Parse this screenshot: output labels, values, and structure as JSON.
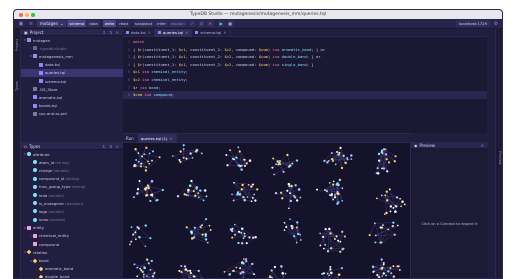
{
  "window": {
    "title": "TypeDB Studio — mutagenesis/mutagenesis_mm/queries.tql"
  },
  "colors": {
    "accent": "#8f85ff",
    "entity": "#f0a0e0",
    "relation": "#ffd46b",
    "attribute": "#7fe0ff"
  },
  "toolbar": {
    "database": "mutagen",
    "session_types": [
      "schema",
      "data"
    ],
    "transaction_types": [
      "write",
      "read"
    ],
    "options": [
      "snapshot",
      "infer",
      "explain"
    ],
    "server": "localhost:1729"
  },
  "project": {
    "title": "Project",
    "items": [
      {
        "label": "mutagen",
        "indent": 0,
        "arrow": "▾",
        "kind": "folder"
      },
      {
        "label": ".typedb-studio",
        "indent": 1,
        "arrow": "›",
        "kind": "folder-dim",
        "dim": true
      },
      {
        "label": "mutagenesis_mm",
        "indent": 1,
        "arrow": "▾",
        "kind": "folder"
      },
      {
        "label": "data.tql",
        "indent": 2,
        "arrow": "",
        "kind": "file"
      },
      {
        "label": "queries.tql",
        "indent": 2,
        "arrow": "",
        "kind": "file",
        "selected": true
      },
      {
        "label": "schema.tql",
        "indent": 2,
        "arrow": "",
        "kind": "file"
      },
      {
        "label": ".DS_Store",
        "indent": 1,
        "arrow": "",
        "kind": "file-plain"
      },
      {
        "label": "aromatic.tql",
        "indent": 1,
        "arrow": "",
        "kind": "file"
      },
      {
        "label": "bonds.tql",
        "indent": 1,
        "arrow": "",
        "kind": "file"
      },
      {
        "label": "cpc-and-ss.pnt",
        "indent": 1,
        "arrow": "",
        "kind": "file-plain"
      }
    ]
  },
  "editor": {
    "tabs": [
      {
        "label": "data.tql",
        "active": false
      },
      {
        "label": "queries.tql",
        "active": true
      },
      {
        "label": "schema.tql",
        "active": false
      }
    ],
    "lines": [
      [
        [
          "kw",
          "match"
        ]
      ],
      [
        [
          "ct",
          "{ "
        ],
        [
          "var",
          "$r"
        ],
        [
          "ct",
          "(constituent_1: "
        ],
        [
          "var",
          "$c1"
        ],
        [
          "ct",
          ", constituent_2: "
        ],
        [
          "var",
          "$c2"
        ],
        [
          "ct",
          ", compound: "
        ],
        [
          "var",
          "$com"
        ],
        [
          "ct",
          ") "
        ],
        [
          "kw",
          "isa "
        ],
        [
          "type",
          "aromatic_bond"
        ],
        [
          "ct",
          "; } or"
        ]
      ],
      [
        [
          "ct",
          "{ "
        ],
        [
          "var",
          "$r"
        ],
        [
          "ct",
          "(constituent_1: "
        ],
        [
          "var",
          "$c1"
        ],
        [
          "ct",
          ", constituent_2: "
        ],
        [
          "var",
          "$c2"
        ],
        [
          "ct",
          ", compound: "
        ],
        [
          "var",
          "$com"
        ],
        [
          "ct",
          ") "
        ],
        [
          "kw",
          "isa "
        ],
        [
          "type",
          "double_bond"
        ],
        [
          "ct",
          "; } or"
        ]
      ],
      [
        [
          "ct",
          "{ "
        ],
        [
          "var",
          "$r"
        ],
        [
          "ct",
          "(constituent_1: "
        ],
        [
          "var",
          "$c1"
        ],
        [
          "ct",
          ", constituent_2: "
        ],
        [
          "var",
          "$c2"
        ],
        [
          "ct",
          ", compound: "
        ],
        [
          "var",
          "$com"
        ],
        [
          "ct",
          ") "
        ],
        [
          "kw",
          "isa "
        ],
        [
          "type",
          "single_bond"
        ],
        [
          "ct",
          "; }"
        ]
      ],
      [
        [
          "var",
          "$c1"
        ],
        [
          "ct",
          " "
        ],
        [
          "kw",
          "isa "
        ],
        [
          "type",
          "chemical_entity"
        ],
        [
          "ct",
          ";"
        ]
      ],
      [
        [
          "var",
          "$c2"
        ],
        [
          "ct",
          " "
        ],
        [
          "kw",
          "isa "
        ],
        [
          "type",
          "chemical_entity"
        ],
        [
          "ct",
          ";"
        ]
      ],
      [
        [
          "var",
          "$r"
        ],
        [
          "ct",
          " "
        ],
        [
          "kw",
          "isa "
        ],
        [
          "type",
          "bond"
        ],
        [
          "ct",
          ";"
        ]
      ],
      [
        [
          "var",
          "$com"
        ],
        [
          "ct",
          " "
        ],
        [
          "kw",
          "isa "
        ],
        [
          "type",
          "compound"
        ],
        [
          "ct",
          ";"
        ]
      ]
    ]
  },
  "types": {
    "title": "Types",
    "items": [
      {
        "label": "attribute",
        "indent": 0,
        "arrow": "▾",
        "kind": "attribute"
      },
      {
        "label": "atom_id",
        "hint": "(string)",
        "indent": 1,
        "kind": "attribute"
      },
      {
        "label": "charge",
        "hint": "(double)",
        "indent": 1,
        "kind": "attribute"
      },
      {
        "label": "compound_id",
        "hint": "(string)",
        "indent": 1,
        "kind": "attribute"
      },
      {
        "label": "func_group_type",
        "hint": "(string)",
        "indent": 1,
        "kind": "attribute"
      },
      {
        "label": "inda",
        "hint": "(double)",
        "indent": 1,
        "kind": "attribute"
      },
      {
        "label": "is_mutagenic",
        "hint": "(boolean)",
        "indent": 1,
        "kind": "attribute"
      },
      {
        "label": "logp",
        "hint": "(double)",
        "indent": 1,
        "kind": "attribute"
      },
      {
        "label": "lumo",
        "hint": "(double)",
        "indent": 1,
        "kind": "attribute"
      },
      {
        "label": "entity",
        "indent": 0,
        "arrow": "▾",
        "kind": "entity"
      },
      {
        "label": "chemical_entity",
        "indent": 1,
        "arrow": "›",
        "kind": "entity"
      },
      {
        "label": "compound",
        "indent": 1,
        "kind": "entity"
      },
      {
        "label": "relation",
        "indent": 0,
        "arrow": "▾",
        "kind": "relation"
      },
      {
        "label": "bond",
        "indent": 1,
        "arrow": "▾",
        "kind": "relation"
      },
      {
        "label": "aromatic_bond",
        "indent": 2,
        "kind": "relation"
      },
      {
        "label": "double_bond",
        "indent": 2,
        "kind": "relation"
      }
    ]
  },
  "run": {
    "label": "Run",
    "tab": "queries.tql (1)"
  },
  "preview": {
    "title": "Preview",
    "empty": "Click on a Concept to inspect it"
  },
  "side_tabs": {
    "left": [
      "Project",
      "Types"
    ],
    "right": [
      "Preview"
    ]
  }
}
